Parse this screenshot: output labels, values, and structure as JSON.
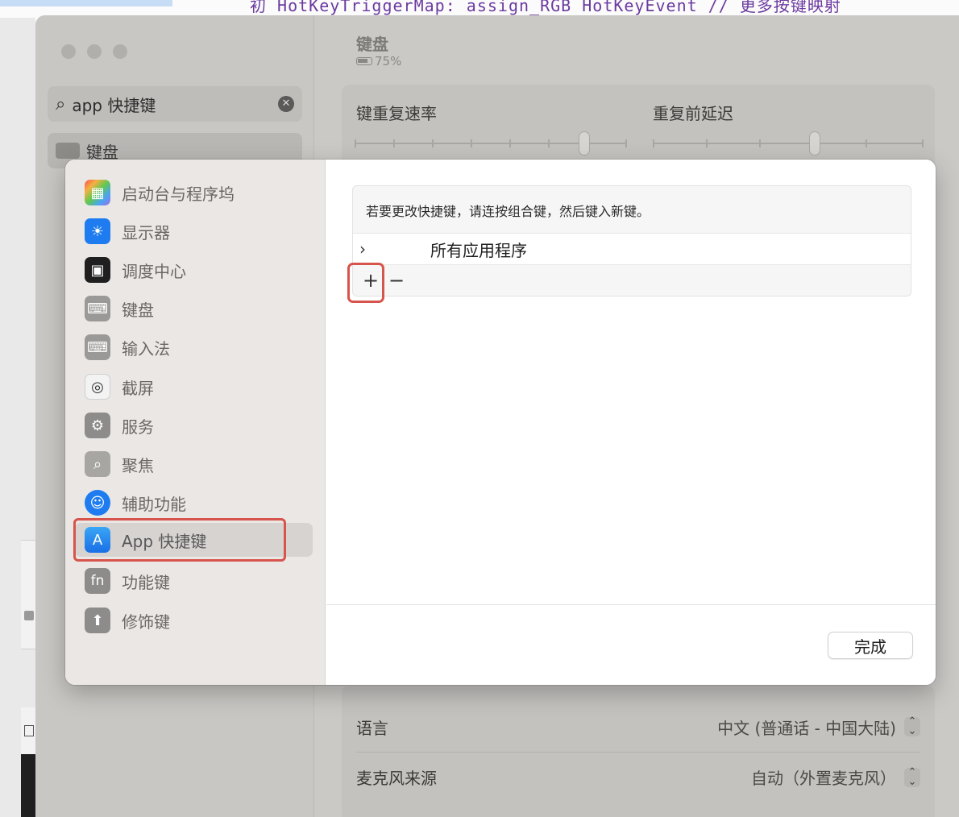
{
  "background": {
    "top_code_text": "初 HotKeyTriggerMap: assign_RGB HotKeyEvent // 更多按键映射"
  },
  "settings": {
    "search_query": "app 快捷键",
    "search_result": "键盘",
    "pane_title": "键盘",
    "battery": "75%",
    "key_repeat_label": "键重复速率",
    "delay_label": "重复前延迟",
    "rows": [
      {
        "label": "语言",
        "value": "中文 (普通话 - 中国大陆)"
      },
      {
        "label": "麦克风来源",
        "value": "自动（外置麦克风）"
      }
    ]
  },
  "sheet": {
    "sidebar_items": [
      {
        "label": "启动台与程序坞",
        "icon": "launchpad-icon"
      },
      {
        "label": "显示器",
        "icon": "display-icon"
      },
      {
        "label": "调度中心",
        "icon": "mission-control-icon"
      },
      {
        "label": "键盘",
        "icon": "keyboard-icon"
      },
      {
        "label": "输入法",
        "icon": "keyboard-icon"
      },
      {
        "label": "截屏",
        "icon": "screenshot-icon"
      },
      {
        "label": "服务",
        "icon": "services-icon"
      },
      {
        "label": "聚焦",
        "icon": "spotlight-icon"
      },
      {
        "label": "辅助功能",
        "icon": "accessibility-icon"
      },
      {
        "label": "App 快捷键",
        "icon": "app-store-icon",
        "selected": true
      },
      {
        "label": "功能键",
        "icon": "fn-icon"
      },
      {
        "label": "修饰键",
        "icon": "modifier-key-icon"
      }
    ],
    "hint": "若要更改快捷键，请连按组合键，然后键入新键。",
    "group_name": "所有应用程序",
    "chevron": "›",
    "plus": "+",
    "minus": "−",
    "done_label": "完成"
  },
  "colors": {
    "highlight": "#d6544c",
    "accent": "#1e7cf0"
  }
}
